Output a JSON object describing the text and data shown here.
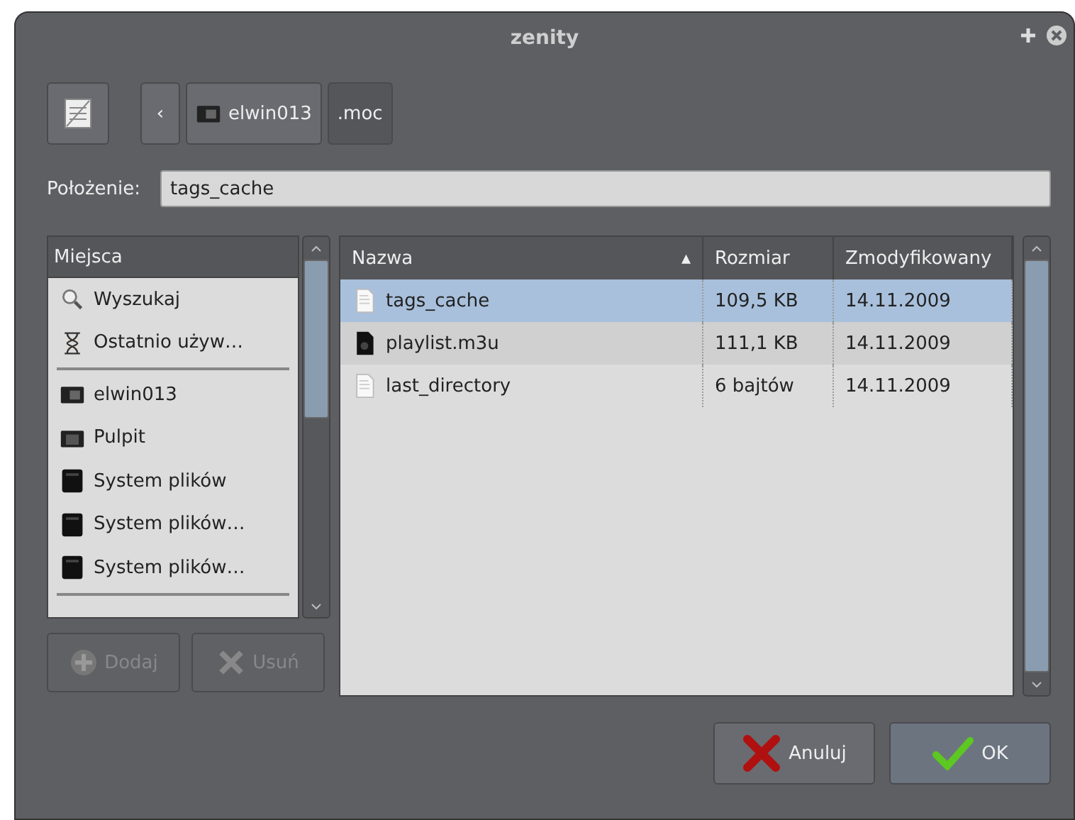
{
  "window": {
    "title": "zenity"
  },
  "path_bar": {
    "back": "‹",
    "crumbs": [
      {
        "label": "elwin013",
        "kind": "home",
        "selected": false
      },
      {
        "label": ".moc",
        "kind": "plain",
        "selected": true
      }
    ]
  },
  "location": {
    "label": "Położenie:",
    "value": "tags_cache"
  },
  "places": {
    "header": "Miejsca",
    "items": [
      {
        "kind": "search",
        "label": "Wyszukaj"
      },
      {
        "kind": "recent",
        "label": "Ostatnio używ…"
      },
      {
        "kind": "separator"
      },
      {
        "kind": "home",
        "label": "elwin013"
      },
      {
        "kind": "folder",
        "label": "Pulpit"
      },
      {
        "kind": "drive",
        "label": "System plików"
      },
      {
        "kind": "drive",
        "label": "System plików…"
      },
      {
        "kind": "drive",
        "label": "System plików…"
      },
      {
        "kind": "separator"
      }
    ],
    "buttons": [
      {
        "kind": "add",
        "label": "Dodaj",
        "disabled": true
      },
      {
        "kind": "remove",
        "label": "Usuń",
        "disabled": true
      }
    ]
  },
  "files": {
    "columns": [
      {
        "label": "Nazwa",
        "sort": "▴"
      },
      {
        "label": "Rozmiar"
      },
      {
        "label": "Zmodyfikowany"
      }
    ],
    "rows": [
      {
        "kind": "text",
        "name": "tags_cache",
        "size": "109,5 KB",
        "modified": "14.11.2009",
        "selected": true
      },
      {
        "kind": "audio",
        "name": "playlist.m3u",
        "size": "111,1 KB",
        "modified": "14.11.2009",
        "selected": false
      },
      {
        "kind": "text",
        "name": "last_directory",
        "size": "6 bajtów",
        "modified": "14.11.2009",
        "selected": false
      }
    ]
  },
  "actions": [
    {
      "kind": "cancel",
      "label": "Anuluj"
    },
    {
      "kind": "ok",
      "label": "OK"
    }
  ]
}
